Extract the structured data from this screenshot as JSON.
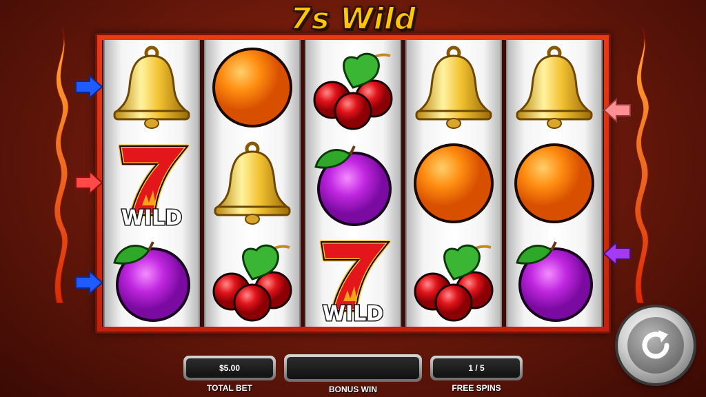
{
  "game": {
    "title": "7s Wild"
  },
  "symbols_legend": {
    "bell": "bell-icon",
    "orange": "orange-icon",
    "cherry": "cherry-icon",
    "plum": "plum-icon",
    "seven_wild": "seven-wild-icon"
  },
  "reels": [
    [
      "bell",
      "seven_wild",
      "plum"
    ],
    [
      "orange",
      "bell",
      "cherry"
    ],
    [
      "cherry",
      "plum",
      "seven_wild"
    ],
    [
      "bell",
      "orange",
      "cherry"
    ],
    [
      "bell",
      "orange",
      "plum"
    ]
  ],
  "wild_label": "WILD",
  "paylines": {
    "left": [
      "blue",
      "red",
      "blue"
    ],
    "right": [
      "pink",
      "purple"
    ]
  },
  "colors": {
    "title": "#ffc60a",
    "frame": "#e83a12",
    "payline_blue": "#1f5cff",
    "payline_red": "#ff4a4a",
    "payline_pink": "#ff8f93",
    "payline_purple": "#a53bf0"
  },
  "hud": {
    "total_bet_value": "$5.00",
    "total_bet_label": "TOTAL BET",
    "bonus_win_value": "",
    "bonus_win_label": "BONUS WIN",
    "free_spins_value": "1 / 5",
    "free_spins_label": "FREE SPINS"
  },
  "controls": {
    "spin_icon": "refresh-icon"
  }
}
